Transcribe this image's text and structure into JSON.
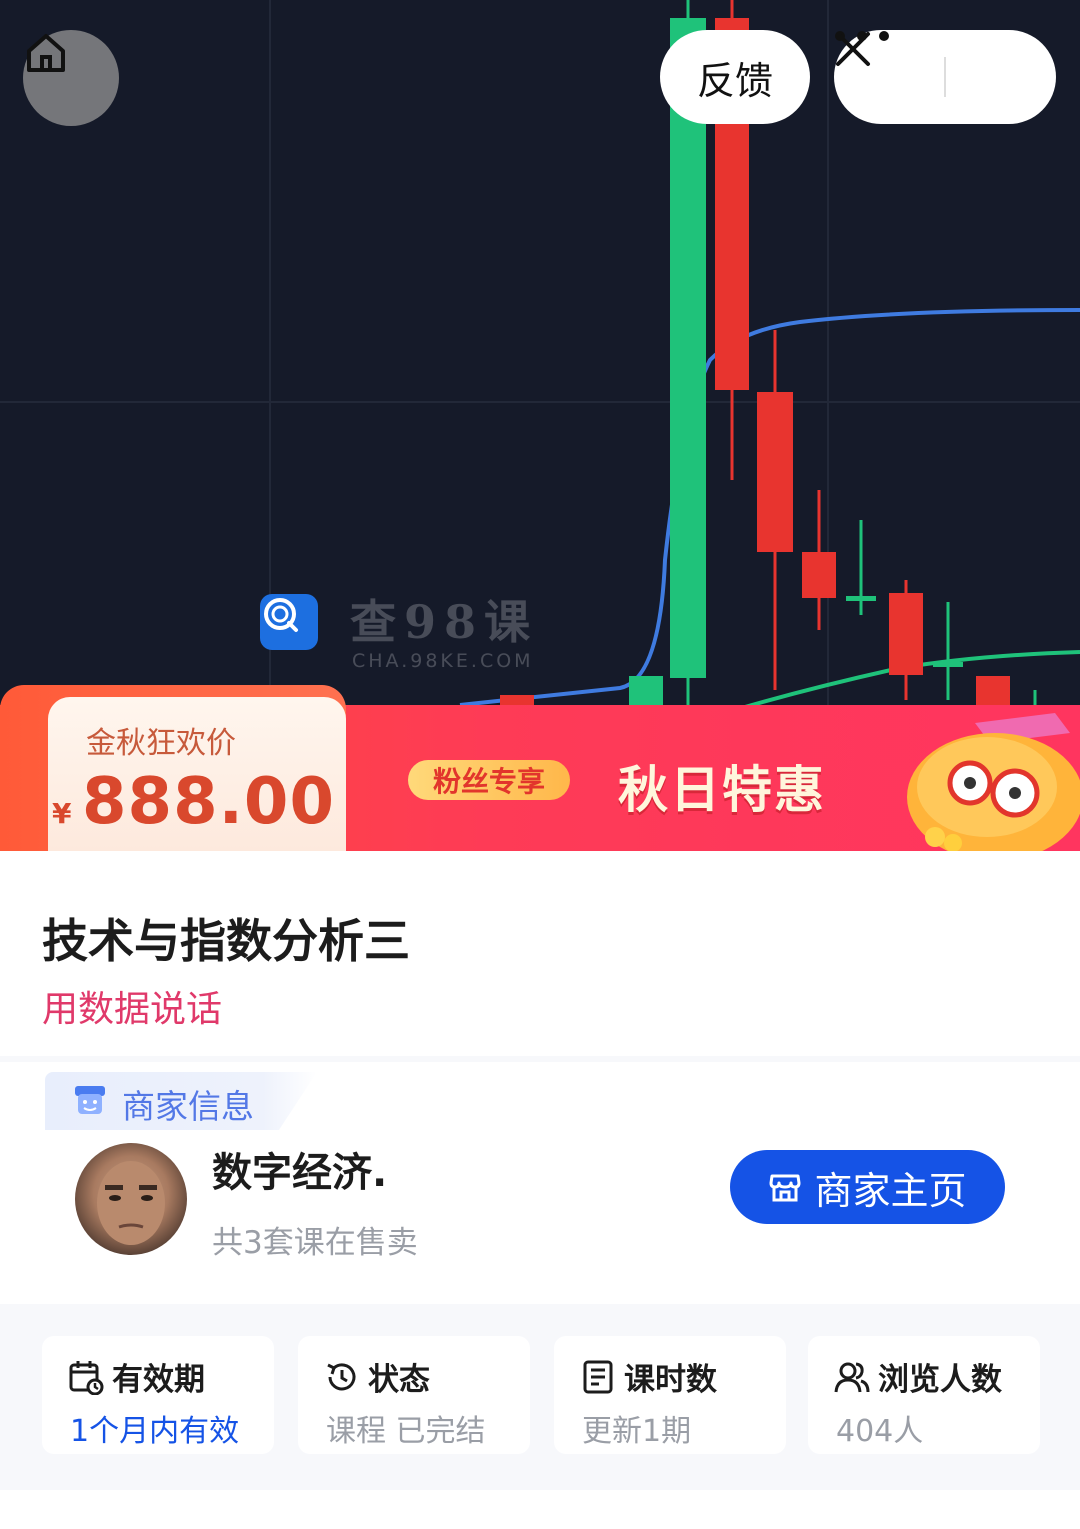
{
  "top_bar": {
    "feedback_label": "反馈",
    "icons": [
      "home-icon",
      "more-icon",
      "close-icon"
    ]
  },
  "hero": {
    "watermark_title": "查98课",
    "watermark_url": "CHA.98KE.COM"
  },
  "promo": {
    "price_label": "金秋狂欢价",
    "currency": "¥",
    "price": "888.00",
    "fans_tag": "粉丝专享",
    "title": "秋日特惠"
  },
  "course": {
    "title": "技术与指数分析三",
    "subtitle": "用数据说话"
  },
  "merchant": {
    "section_label": "商家信息",
    "name": "数字经济.",
    "course_count": "共3套课在售卖",
    "shop_button": "商家主页"
  },
  "stats": [
    {
      "icon": "calendar-icon",
      "label": "有效期",
      "value": "1个月内有效",
      "accent": true
    },
    {
      "icon": "history-icon",
      "label": "状态",
      "value": "课程 已完结",
      "accent": false
    },
    {
      "icon": "document-icon",
      "label": "课时数",
      "value": "更新1期",
      "accent": false
    },
    {
      "icon": "users-icon",
      "label": "浏览人数",
      "value": "404人",
      "accent": false
    }
  ],
  "colors": {
    "accent_blue": "#1553e6",
    "subtitle_pink": "#e0396a",
    "price_red": "#d9482d",
    "candle_red": "#e8342f",
    "candle_green": "#1fc27a",
    "ma_blue": "#3f7be0",
    "hero_bg": "#151a29"
  }
}
